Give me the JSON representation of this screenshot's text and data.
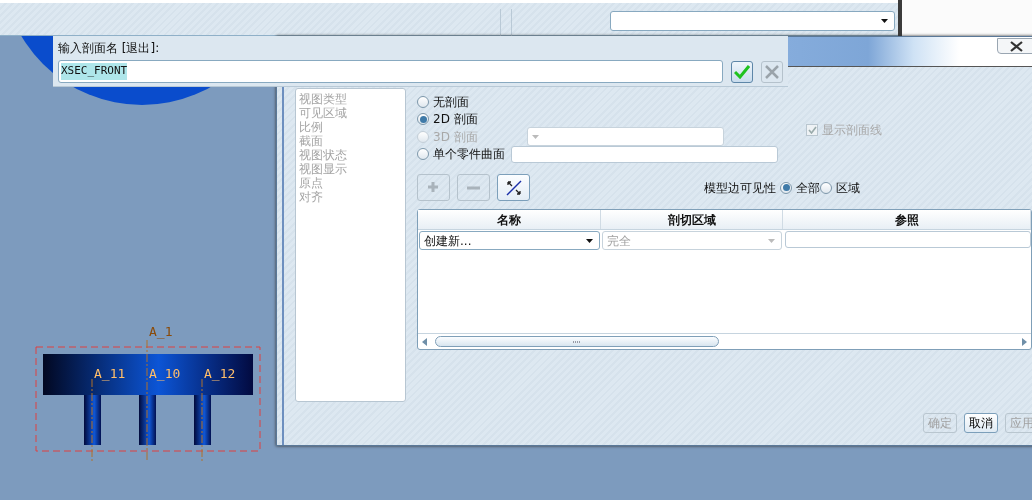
{
  "prompt": {
    "label": "输入剖面名 [退出]:",
    "value": "XSEC_FRONT",
    "value_selected": true,
    "buttons": [
      {
        "kind": "ok",
        "disabled": false
      },
      {
        "kind": "cancel",
        "disabled": true
      }
    ]
  },
  "dialog": {
    "categories": [
      {
        "label": "视图类型",
        "disabled": true
      },
      {
        "label": "可见区域",
        "disabled": true
      },
      {
        "label": "比例",
        "disabled": true
      },
      {
        "label": "截面",
        "disabled": true
      },
      {
        "label": "视图状态",
        "disabled": true
      },
      {
        "label": "视图显示",
        "disabled": true
      },
      {
        "label": "原点",
        "disabled": true
      },
      {
        "label": "对齐",
        "disabled": true
      }
    ],
    "section_options": [
      {
        "label": "无剖面",
        "selected": false,
        "disabled": false
      },
      {
        "label": "2D 剖面",
        "selected": true,
        "disabled": false
      },
      {
        "label": "3D 剖面",
        "selected": false,
        "disabled": true
      },
      {
        "label": "单个零件曲面",
        "selected": false,
        "disabled": false
      }
    ],
    "show_hatch": {
      "label": "显示剖面线",
      "checked": true,
      "disabled": true
    },
    "tool_buttons": [
      {
        "kind": "add",
        "disabled": true
      },
      {
        "kind": "remove",
        "disabled": true
      },
      {
        "kind": "flip",
        "disabled": false
      }
    ],
    "edge_visibility": {
      "label": "模型边可见性",
      "options": [
        {
          "label": "全部",
          "selected": true
        },
        {
          "label": "区域",
          "selected": false
        }
      ]
    },
    "table": {
      "columns": [
        "名称",
        "剖切区域",
        "参照"
      ],
      "rows": [
        {
          "name": "创建新...",
          "region": "完全",
          "region_disabled": true
        }
      ]
    },
    "buttons": [
      {
        "label": "确定",
        "disabled": true
      },
      {
        "label": "取消",
        "disabled": false
      },
      {
        "label": "应用",
        "disabled": true
      }
    ]
  },
  "model": {
    "labels": [
      {
        "text": "A_1",
        "kind": "main"
      },
      {
        "text": "A_11",
        "kind": "left"
      },
      {
        "text": "A_10",
        "kind": "center"
      },
      {
        "text": "A_12",
        "kind": "right"
      }
    ]
  }
}
